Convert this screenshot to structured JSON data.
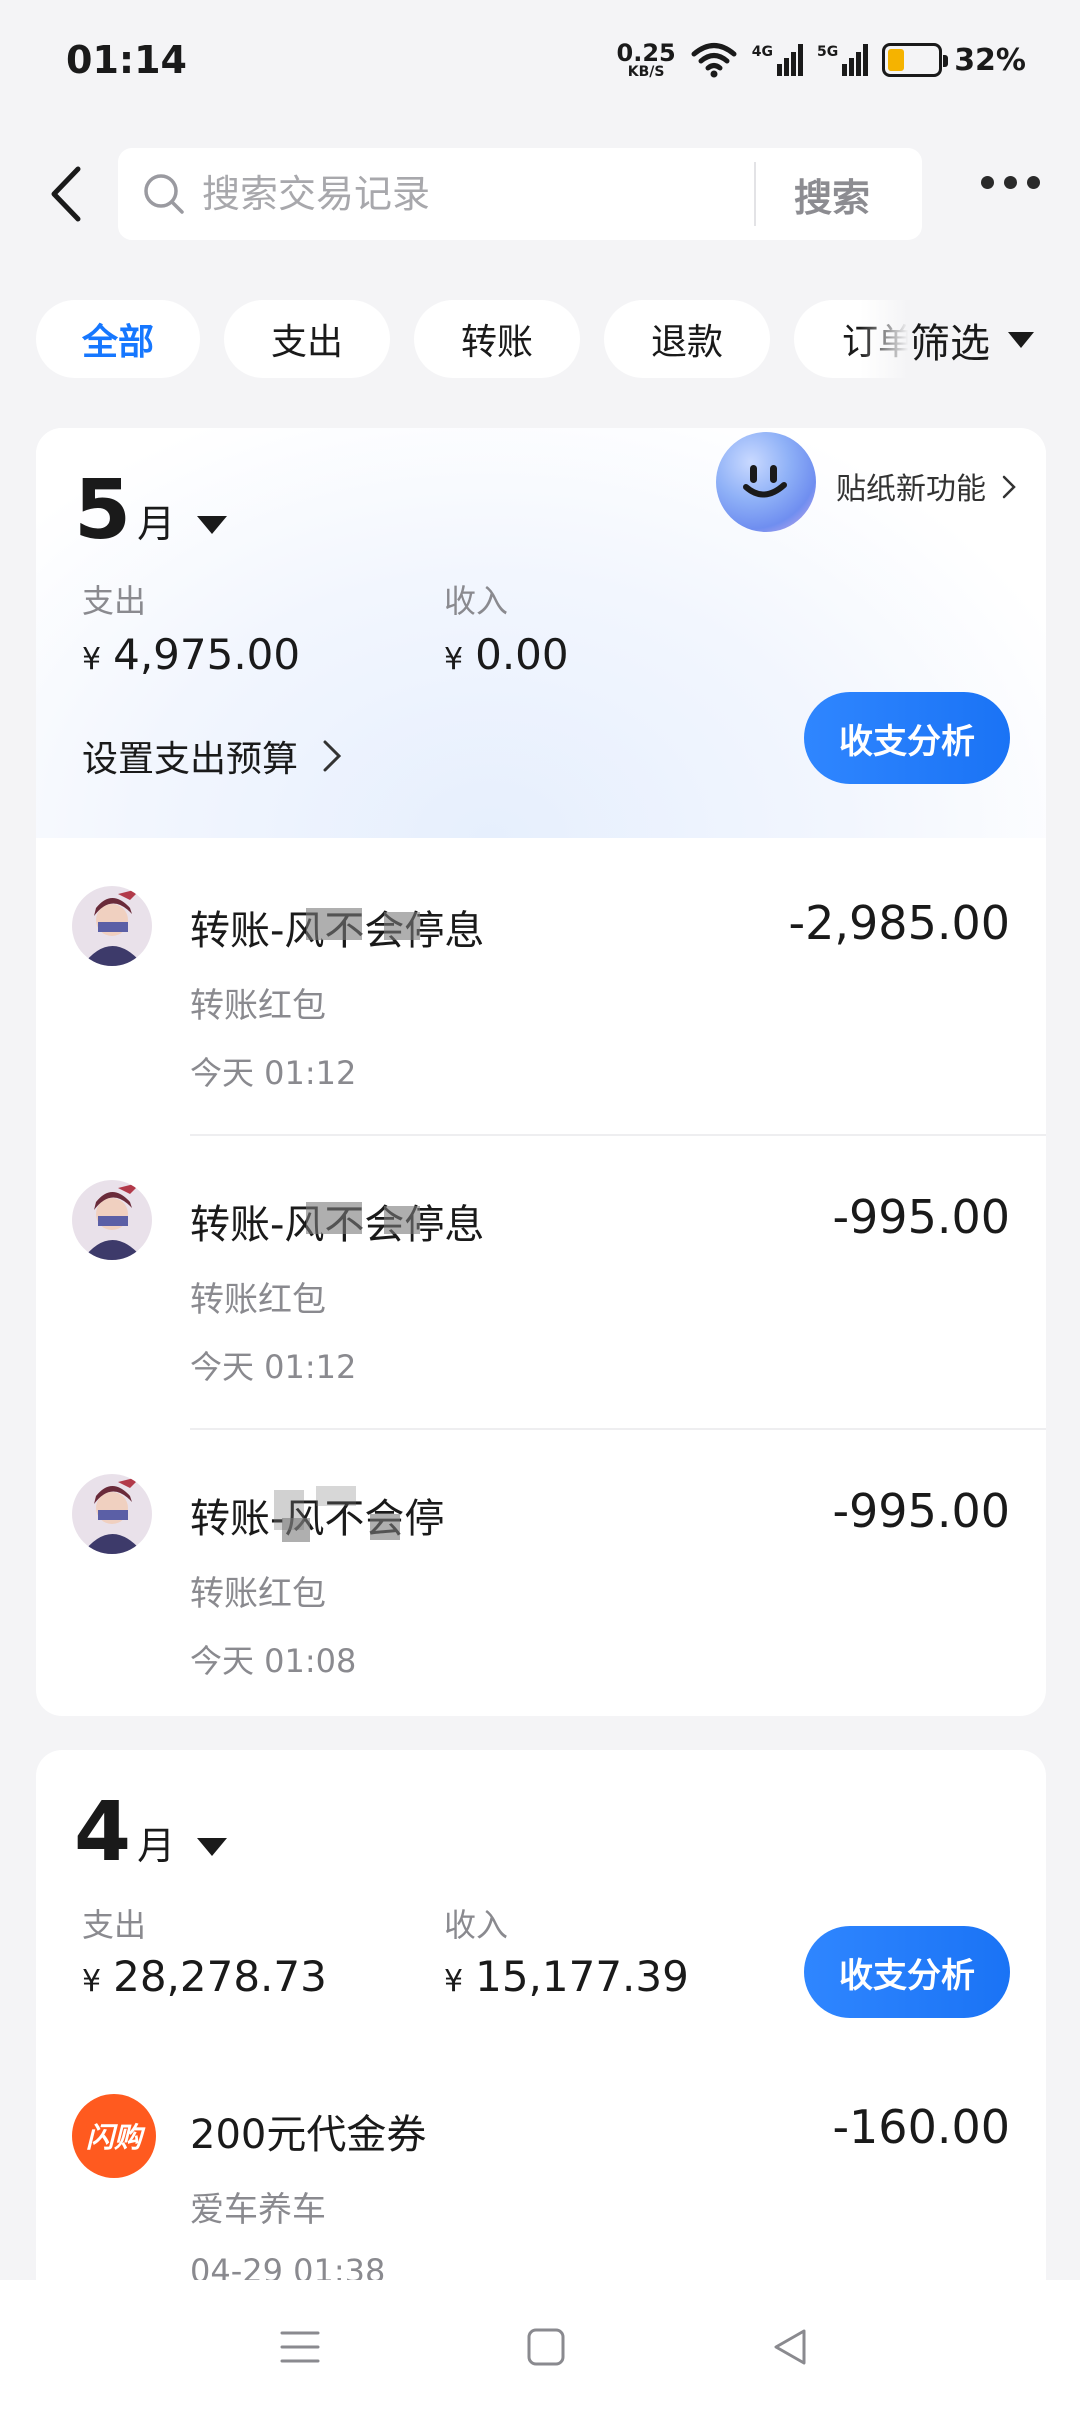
{
  "status_bar": {
    "time": "01:14",
    "net_speed_value": "0.25",
    "net_speed_unit": "KB/S",
    "signal1_label": "4G",
    "signal2_label": "5G",
    "battery_percent": "32%",
    "battery_level": 0.32
  },
  "header": {
    "search_placeholder": "搜索交易记录",
    "search_button": "搜索"
  },
  "filters": {
    "chips": [
      "全部",
      "支出",
      "转账",
      "退款",
      "订单"
    ],
    "active_index": 0,
    "filter_label": "筛选"
  },
  "sticker_promo": {
    "label": "贴纸新功能"
  },
  "months": [
    {
      "month_number": "5",
      "month_unit": "月",
      "expense_label": "支出",
      "expense_currency": "¥",
      "expense_value": "4,975.00",
      "income_label": "收入",
      "income_currency": "¥",
      "income_value": "0.00",
      "budget_link": "设置支出预算",
      "analysis_button": "收支分析",
      "transactions": [
        {
          "title": "转账-风不会停息",
          "category": "转账红包",
          "time": "今天 01:12",
          "amount": "-2,985.00"
        },
        {
          "title": "转账-风不会停息",
          "category": "转账红包",
          "time": "今天 01:12",
          "amount": "-995.00"
        },
        {
          "title": "转账-风不会停",
          "category": "转账红包",
          "time": "今天 01:08",
          "amount": "-995.00"
        }
      ]
    },
    {
      "month_number": "4",
      "month_unit": "月",
      "expense_label": "支出",
      "expense_currency": "¥",
      "expense_value": "28,278.73",
      "income_label": "收入",
      "income_currency": "¥",
      "income_value": "15,177.39",
      "analysis_button": "收支分析",
      "transactions": [
        {
          "title": "200元代金券",
          "category": "爱车养车",
          "time": "04-29 01:38",
          "amount": "-160.00",
          "logo_text": "闪购"
        }
      ]
    }
  ],
  "colors": {
    "accent": "#1677ff",
    "page_bg": "#f4f4f6",
    "battery": "#f5b300",
    "shangou_logo": "#ff5a1f"
  }
}
